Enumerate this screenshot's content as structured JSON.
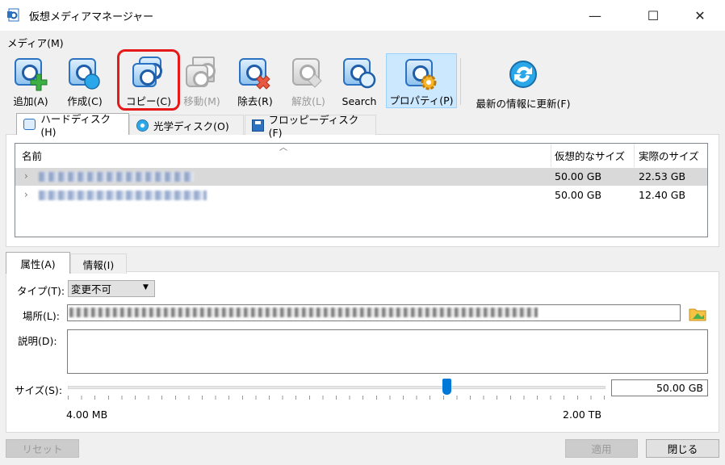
{
  "window": {
    "title": "仮想メディアマネージャー",
    "controls": {
      "minimize": "—",
      "maximize": "☐",
      "close": "✕"
    }
  },
  "menu": {
    "media": "メディア(M)"
  },
  "toolbar": {
    "items": [
      {
        "label": "追加(A)",
        "icon": "add-disk-icon",
        "enabled": true
      },
      {
        "label": "作成(C)",
        "icon": "create-disk-icon",
        "enabled": true
      },
      {
        "label": "コピー(C)",
        "icon": "copy-disk-icon",
        "enabled": true,
        "highlighted": true
      },
      {
        "label": "移動(M)",
        "icon": "move-disk-icon",
        "enabled": false
      },
      {
        "label": "除去(R)",
        "icon": "remove-disk-icon",
        "enabled": true
      },
      {
        "label": "解放(L)",
        "icon": "release-disk-icon",
        "enabled": false
      },
      {
        "label": "Search",
        "icon": "search-disk-icon",
        "enabled": true
      },
      {
        "label": "プロパティ(P)",
        "icon": "properties-disk-icon",
        "enabled": true,
        "pressed": true
      },
      {
        "label": "最新の情報に更新(F)",
        "icon": "refresh-icon",
        "enabled": true
      }
    ]
  },
  "tabs": [
    {
      "label": "ハードディスク(H)",
      "icon": "hard-disk-icon",
      "active": true
    },
    {
      "label": "光学ディスク(O)",
      "icon": "optical-disc-icon",
      "active": false
    },
    {
      "label": "フロッピーディスク(F)",
      "icon": "floppy-disk-icon",
      "active": false
    }
  ],
  "list": {
    "columns": [
      "名前",
      "仮想的なサイズ",
      "実際のサイズ"
    ],
    "rows": [
      {
        "virtual_size": "50.00 GB",
        "actual_size": "22.53 GB",
        "selected": true
      },
      {
        "virtual_size": "50.00 GB",
        "actual_size": "12.40 GB",
        "selected": false
      }
    ]
  },
  "detail_tabs": [
    {
      "label": "属性(A)",
      "active": true
    },
    {
      "label": "情報(I)",
      "active": false
    }
  ],
  "attributes": {
    "type_label": "タイプ(T):",
    "type_value": "変更不可",
    "location_label": "場所(L):",
    "description_label": "説明(D):",
    "size_label": "サイズ(S):",
    "size_value": "50.00 GB",
    "size_min": "4.00 MB",
    "size_max": "2.00 TB",
    "slider_position": 0.705
  },
  "buttons": {
    "reset": "リセット",
    "apply": "適用",
    "close": "閉じる"
  },
  "colors": {
    "accent": "#0078d7",
    "highlight_box": "#e51919",
    "selected_row": "#d9d9d9",
    "pressed_button": "#cce8ff"
  }
}
